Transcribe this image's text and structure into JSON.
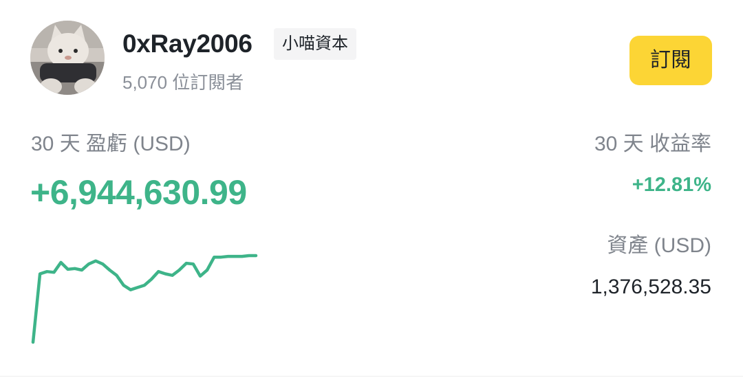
{
  "profile": {
    "username": "0xRay2006",
    "tag": "小喵資本",
    "subscribers": "5,070 位訂閱者",
    "subscribe_label": "訂閱"
  },
  "stats": {
    "pnl_label": "30 天 盈虧 (USD)",
    "pnl_value": "+6,944,630.99",
    "roi_label": "30 天 收益率",
    "roi_value": "+12.81%",
    "assets_label": "資產 (USD)",
    "assets_value": "1,376,528.35"
  },
  "colors": {
    "positive": "#3eb489",
    "accent": "#fcd535",
    "text_primary": "#1e2329",
    "text_secondary": "#7f848c"
  },
  "icons": {
    "avatar": "cat-plush-avatar"
  },
  "chart_data": {
    "type": "line",
    "series": [
      {
        "values": [
          5,
          95,
          98,
          97,
          110,
          101,
          102,
          100,
          108,
          112,
          108,
          100,
          93,
          80,
          74,
          77,
          80,
          88,
          98,
          95,
          93,
          100,
          109,
          108,
          92,
          100,
          117,
          117,
          118,
          118,
          118,
          119,
          119
        ]
      }
    ]
  }
}
